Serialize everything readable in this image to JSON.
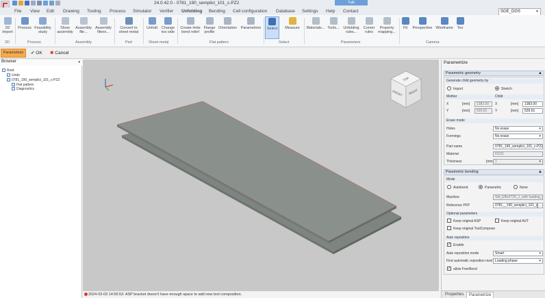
{
  "window": {
    "title": "24.0.42.0 - 0781_190_semplici_101_c-PZ2",
    "version_badge": "Tutti"
  },
  "menu": {
    "items": [
      "File",
      "View",
      "Edit",
      "Drawing",
      "Tooling",
      "Process",
      "Simulator",
      "Verifier",
      "Unfolding",
      "Bending",
      "Cell configuration",
      "Database",
      "Settings",
      "Help",
      "Contact"
    ],
    "search_value": "SGE_DGS"
  },
  "ribbon": {
    "buttons": [
      {
        "label": "2D Import",
        "icon": "import-icon"
      },
      {
        "label": "Process",
        "icon": "process-icon"
      },
      {
        "label": "Feasibility study",
        "icon": "feasibility-icon"
      },
      {
        "label": "Show assembly",
        "icon": "show-assembly-icon"
      },
      {
        "label": "Assembly file...",
        "icon": "assembly-file-icon"
      },
      {
        "label": "Assembly filters...",
        "icon": "assembly-filters-icon"
      },
      {
        "label": "Convert to sheet metal",
        "icon": "convert-icon"
      },
      {
        "label": "Unfold",
        "icon": "unfold-icon"
      },
      {
        "label": "Change too side",
        "icon": "change-side-icon"
      },
      {
        "label": "Create Hole bend relief",
        "icon": "hole-icon"
      },
      {
        "label": "Flange profile",
        "icon": "flange-icon"
      },
      {
        "label": "Orientation",
        "icon": "orientation-icon"
      },
      {
        "label": "Parametrize",
        "icon": "parametrize-icon"
      },
      {
        "label": "Select",
        "icon": "select-icon"
      },
      {
        "label": "Measure",
        "icon": "measure-icon"
      },
      {
        "label": "Materials...",
        "icon": "materials-icon"
      },
      {
        "label": "Tools...",
        "icon": "tools-icon"
      },
      {
        "label": "Unfolding rules...",
        "icon": "unfolding-rules-icon"
      },
      {
        "label": "Corner rules",
        "icon": "corner-rules-icon"
      },
      {
        "label": "Property mapping...",
        "icon": "property-mapping-icon"
      },
      {
        "label": "Fit",
        "icon": "fit-icon"
      },
      {
        "label": "Perspective",
        "icon": "perspective-icon"
      },
      {
        "label": "Wireframe",
        "icon": "wireframe-icon"
      },
      {
        "label": "Too",
        "icon": "toolbar-more-icon"
      }
    ],
    "groups": [
      "2D",
      "Process",
      "Assembly",
      "Part",
      "Sheet metal",
      "Flat pattern",
      "Select",
      "Parameters",
      "Camera"
    ]
  },
  "command_bar": {
    "tab_label": "Parametrize",
    "ok_label": "OK",
    "cancel_label": "Cancel"
  },
  "browser": {
    "title": "Browser",
    "items": [
      "Root",
      "Undo",
      "0781_190_semplici_101_c-PZ2",
      "Flat pattern",
      "Diagnostics"
    ]
  },
  "viewcube": {
    "top": "TOP",
    "front": "FRONT",
    "right": "RIGHT"
  },
  "status": {
    "message": "2024-03-03 14:56:53: ASP bracket doesn't have enough space to add new tool composition."
  },
  "right_panel": {
    "title": "Parametrize",
    "geometry": {
      "section_title": "Parametric geometry",
      "generate_label": "Generate child geometry by",
      "import_label": "Import",
      "stretch_label": "Stretch",
      "mother_label": "Mother",
      "child_label": "Child",
      "x_label": "X",
      "y_label": "Y",
      "unit": "[mm]",
      "mother_x": "1383.00",
      "mother_y": "529.61",
      "child_x": "1383.00",
      "child_y": "529.61",
      "erase_mode_label": "Erase mode",
      "holes_label": "Holes",
      "holes_value": "No erase",
      "formings_label": "Formings",
      "formings_value": "No erase",
      "part_name_label": "Part name",
      "part_name_value": "0781_190_semplici_101_c-PZ2_1",
      "material_label": "Material",
      "material_value": "DC01",
      "thickness_label": "Thickness",
      "thickness_unit": "[mm]",
      "thickness_value": "1"
    },
    "bending": {
      "section_title": "Parametric bending",
      "mode_label": "Mode",
      "autobend_label": "Autobend",
      "parametric_label": "Parametric",
      "none_label": "None",
      "machine_label": "Machine",
      "machine_value": "Std_EBe2720_1_with loading_v2",
      "reference_label": "Reference PFP",
      "reference_value": "0781__190_semplici_101_c-PZ2_1",
      "optional_label": "Optional parameters",
      "keep_asp_label": "Keep original ASP",
      "keep_aut_label": "Keep original AUT",
      "keep_toolcompose_label": "Keep original ToolCompose",
      "auto_reposition_label": "Auto reposition",
      "enable_label": "Enable",
      "reposition_mode_label": "Auto reposition mode",
      "reposition_mode_value": "Smart",
      "first_reposition_label": "First automatic reposition mod",
      "first_reposition_value": "Loading phase",
      "allow_freebend_label": "allow FreeBend"
    },
    "tabs": [
      "Properties",
      "Parametrize"
    ]
  }
}
